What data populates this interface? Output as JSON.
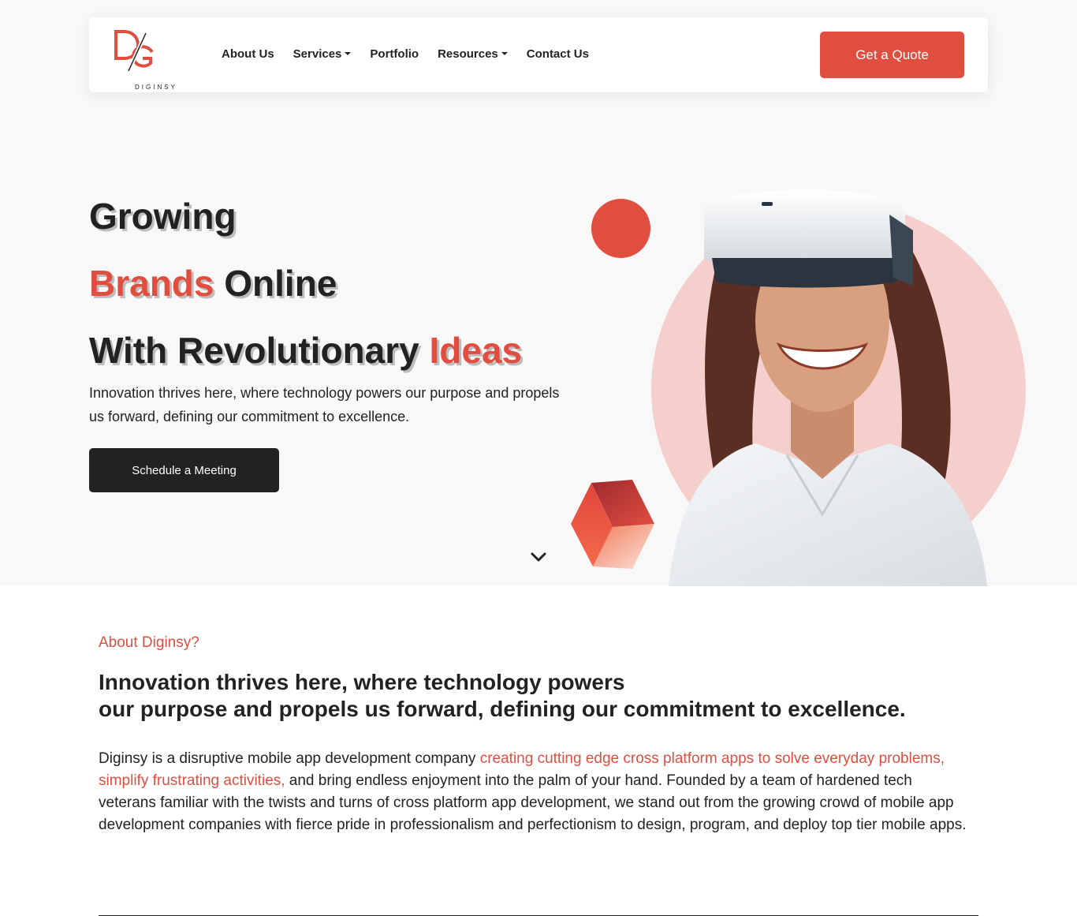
{
  "brand": {
    "name": "DIGINSY",
    "accent_color": "#e04e40",
    "dark_color": "#222222"
  },
  "nav": {
    "items": [
      {
        "label": "About Us",
        "dropdown": false
      },
      {
        "label": "Services",
        "dropdown": true
      },
      {
        "label": "Portfolio",
        "dropdown": false
      },
      {
        "label": "Resources",
        "dropdown": true
      },
      {
        "label": "Contact Us",
        "dropdown": false
      }
    ],
    "cta_label": "Get a Quote"
  },
  "hero": {
    "line1": "Growing",
    "line2_accent": "Brands",
    "line2_rest": " Online",
    "line3_rest": "With Revolutionary ",
    "line3_accent": "Ideas",
    "subtitle": "Innovation thrives here, where technology powers our purpose and propels us forward, defining our commitment to excellence.",
    "button_label": "Schedule a Meeting",
    "scroll_icon": "chevron-down-icon"
  },
  "about": {
    "eyebrow": "About Diginsy?",
    "heading_line1": "Innovation thrives here, where technology powers",
    "heading_line2": "our purpose and propels us forward, defining our commitment to excellence.",
    "body_start": "Diginsy is a disruptive mobile app development company ",
    "body_highlight": "creating cutting edge cross platform apps to solve everyday problems, simplify frustrating activities,",
    "body_end": " and bring endless enjoyment into the palm of your hand. Founded by a team of hardened tech veterans familiar with the twists and turns of cross platform app development, we stand out from the growing crowd of mobile app development companies with fierce pride in professionalism and perfectionism to design, program, and deploy top tier mobile apps."
  }
}
